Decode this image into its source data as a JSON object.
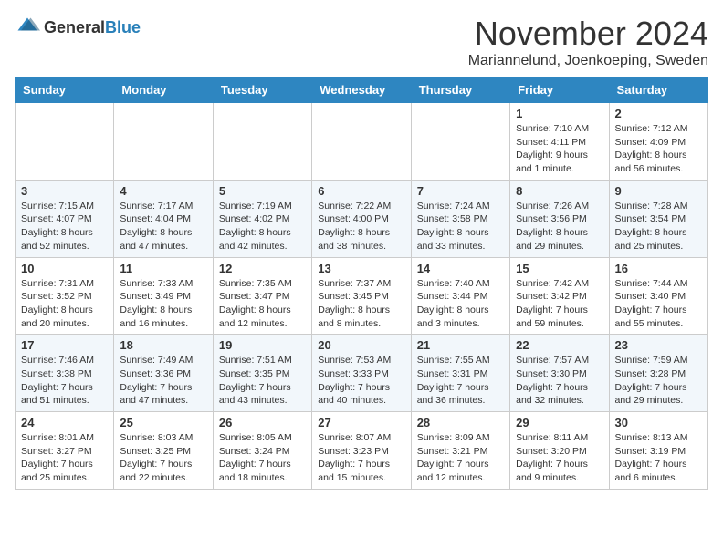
{
  "logo": {
    "general": "General",
    "blue": "Blue"
  },
  "header": {
    "month": "November 2024",
    "location": "Mariannelund, Joenkoeping, Sweden"
  },
  "days_of_week": [
    "Sunday",
    "Monday",
    "Tuesday",
    "Wednesday",
    "Thursday",
    "Friday",
    "Saturday"
  ],
  "weeks": [
    [
      {
        "day": "",
        "info": ""
      },
      {
        "day": "",
        "info": ""
      },
      {
        "day": "",
        "info": ""
      },
      {
        "day": "",
        "info": ""
      },
      {
        "day": "",
        "info": ""
      },
      {
        "day": "1",
        "info": "Sunrise: 7:10 AM\nSunset: 4:11 PM\nDaylight: 9 hours and 1 minute."
      },
      {
        "day": "2",
        "info": "Sunrise: 7:12 AM\nSunset: 4:09 PM\nDaylight: 8 hours and 56 minutes."
      }
    ],
    [
      {
        "day": "3",
        "info": "Sunrise: 7:15 AM\nSunset: 4:07 PM\nDaylight: 8 hours and 52 minutes."
      },
      {
        "day": "4",
        "info": "Sunrise: 7:17 AM\nSunset: 4:04 PM\nDaylight: 8 hours and 47 minutes."
      },
      {
        "day": "5",
        "info": "Sunrise: 7:19 AM\nSunset: 4:02 PM\nDaylight: 8 hours and 42 minutes."
      },
      {
        "day": "6",
        "info": "Sunrise: 7:22 AM\nSunset: 4:00 PM\nDaylight: 8 hours and 38 minutes."
      },
      {
        "day": "7",
        "info": "Sunrise: 7:24 AM\nSunset: 3:58 PM\nDaylight: 8 hours and 33 minutes."
      },
      {
        "day": "8",
        "info": "Sunrise: 7:26 AM\nSunset: 3:56 PM\nDaylight: 8 hours and 29 minutes."
      },
      {
        "day": "9",
        "info": "Sunrise: 7:28 AM\nSunset: 3:54 PM\nDaylight: 8 hours and 25 minutes."
      }
    ],
    [
      {
        "day": "10",
        "info": "Sunrise: 7:31 AM\nSunset: 3:52 PM\nDaylight: 8 hours and 20 minutes."
      },
      {
        "day": "11",
        "info": "Sunrise: 7:33 AM\nSunset: 3:49 PM\nDaylight: 8 hours and 16 minutes."
      },
      {
        "day": "12",
        "info": "Sunrise: 7:35 AM\nSunset: 3:47 PM\nDaylight: 8 hours and 12 minutes."
      },
      {
        "day": "13",
        "info": "Sunrise: 7:37 AM\nSunset: 3:45 PM\nDaylight: 8 hours and 8 minutes."
      },
      {
        "day": "14",
        "info": "Sunrise: 7:40 AM\nSunset: 3:44 PM\nDaylight: 8 hours and 3 minutes."
      },
      {
        "day": "15",
        "info": "Sunrise: 7:42 AM\nSunset: 3:42 PM\nDaylight: 7 hours and 59 minutes."
      },
      {
        "day": "16",
        "info": "Sunrise: 7:44 AM\nSunset: 3:40 PM\nDaylight: 7 hours and 55 minutes."
      }
    ],
    [
      {
        "day": "17",
        "info": "Sunrise: 7:46 AM\nSunset: 3:38 PM\nDaylight: 7 hours and 51 minutes."
      },
      {
        "day": "18",
        "info": "Sunrise: 7:49 AM\nSunset: 3:36 PM\nDaylight: 7 hours and 47 minutes."
      },
      {
        "day": "19",
        "info": "Sunrise: 7:51 AM\nSunset: 3:35 PM\nDaylight: 7 hours and 43 minutes."
      },
      {
        "day": "20",
        "info": "Sunrise: 7:53 AM\nSunset: 3:33 PM\nDaylight: 7 hours and 40 minutes."
      },
      {
        "day": "21",
        "info": "Sunrise: 7:55 AM\nSunset: 3:31 PM\nDaylight: 7 hours and 36 minutes."
      },
      {
        "day": "22",
        "info": "Sunrise: 7:57 AM\nSunset: 3:30 PM\nDaylight: 7 hours and 32 minutes."
      },
      {
        "day": "23",
        "info": "Sunrise: 7:59 AM\nSunset: 3:28 PM\nDaylight: 7 hours and 29 minutes."
      }
    ],
    [
      {
        "day": "24",
        "info": "Sunrise: 8:01 AM\nSunset: 3:27 PM\nDaylight: 7 hours and 25 minutes."
      },
      {
        "day": "25",
        "info": "Sunrise: 8:03 AM\nSunset: 3:25 PM\nDaylight: 7 hours and 22 minutes."
      },
      {
        "day": "26",
        "info": "Sunrise: 8:05 AM\nSunset: 3:24 PM\nDaylight: 7 hours and 18 minutes."
      },
      {
        "day": "27",
        "info": "Sunrise: 8:07 AM\nSunset: 3:23 PM\nDaylight: 7 hours and 15 minutes."
      },
      {
        "day": "28",
        "info": "Sunrise: 8:09 AM\nSunset: 3:21 PM\nDaylight: 7 hours and 12 minutes."
      },
      {
        "day": "29",
        "info": "Sunrise: 8:11 AM\nSunset: 3:20 PM\nDaylight: 7 hours and 9 minutes."
      },
      {
        "day": "30",
        "info": "Sunrise: 8:13 AM\nSunset: 3:19 PM\nDaylight: 7 hours and 6 minutes."
      }
    ]
  ]
}
